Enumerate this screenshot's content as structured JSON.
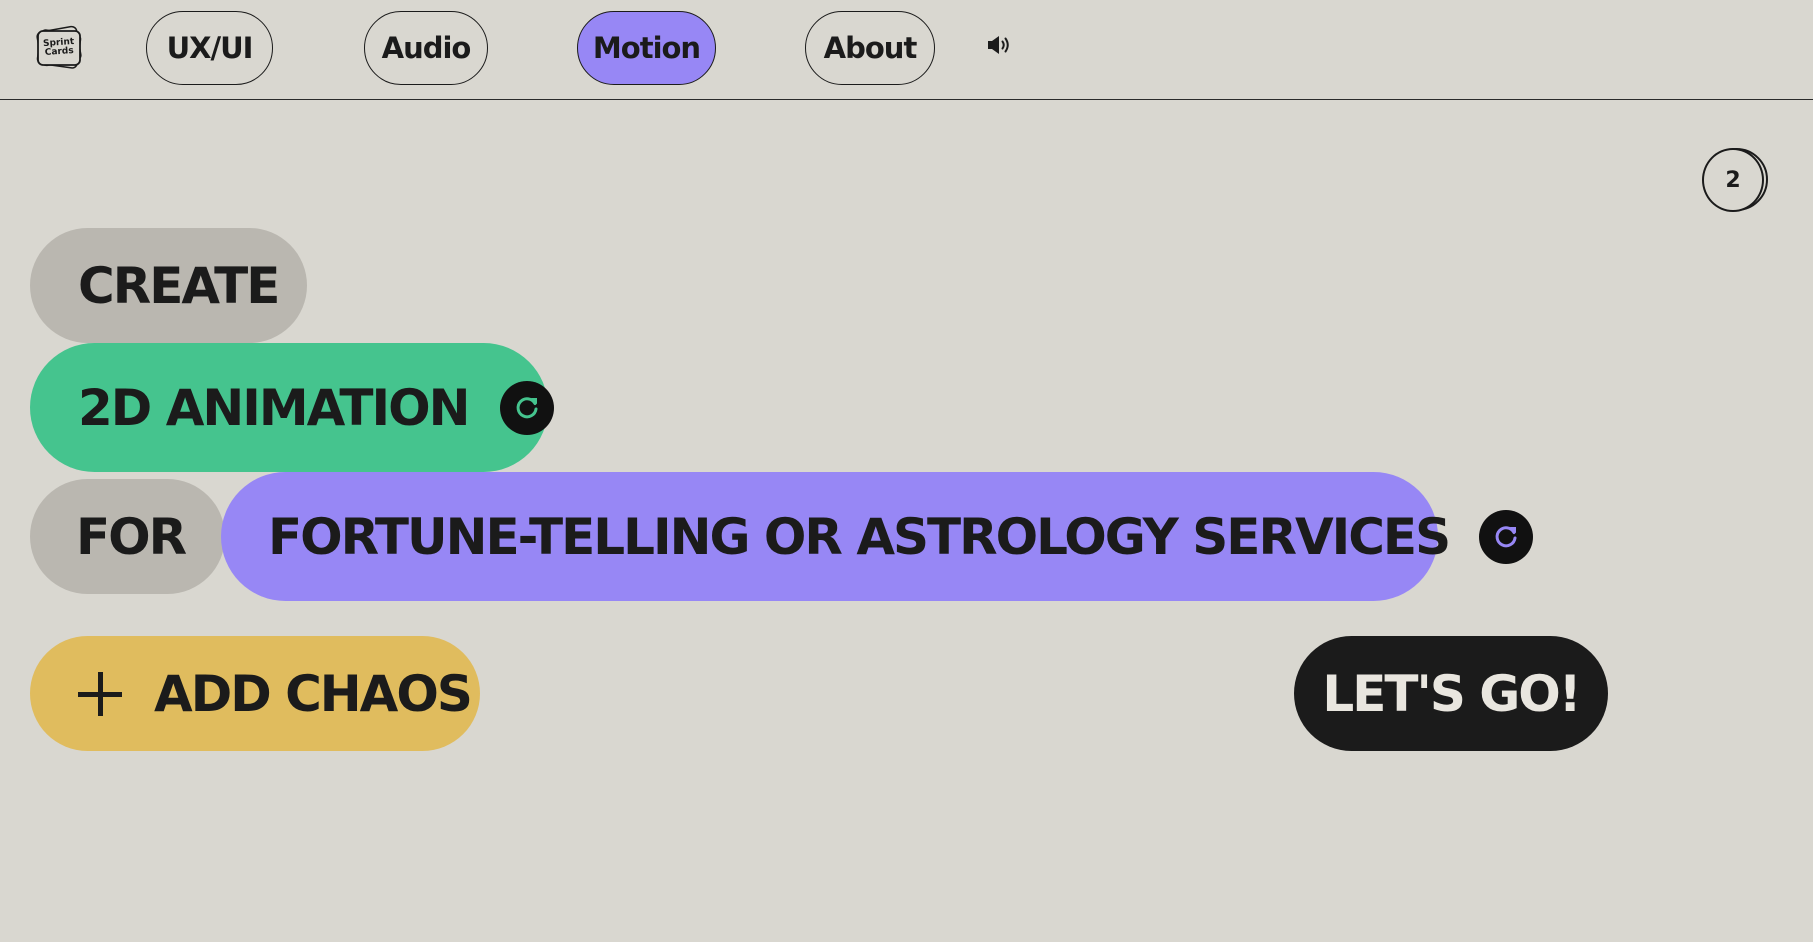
{
  "logo": {
    "line1": "Sprint",
    "line2": "Cards"
  },
  "nav": {
    "items": [
      {
        "label": "UX/UI",
        "active": false
      },
      {
        "label": "Audio",
        "active": false
      },
      {
        "label": "Motion",
        "active": true
      },
      {
        "label": "About",
        "active": false
      }
    ],
    "sound_icon": "speaker-icon"
  },
  "counter": {
    "value": "2"
  },
  "sentence": {
    "verb": "CREATE",
    "subject": "2D ANIMATION",
    "connector": "FOR",
    "target": "FORTUNE-TELLING OR ASTROLOGY SERVICES"
  },
  "actions": {
    "add_chaos_label": "ADD CHAOS",
    "go_label": "LET'S GO!"
  },
  "colors": {
    "background": "#d9d7d0",
    "accent_purple": "#9787f5",
    "accent_green": "#45c48e",
    "accent_yellow": "#e0bc5e",
    "neutral_pill": "#bab7b0",
    "dark": "#1b1b1b"
  }
}
